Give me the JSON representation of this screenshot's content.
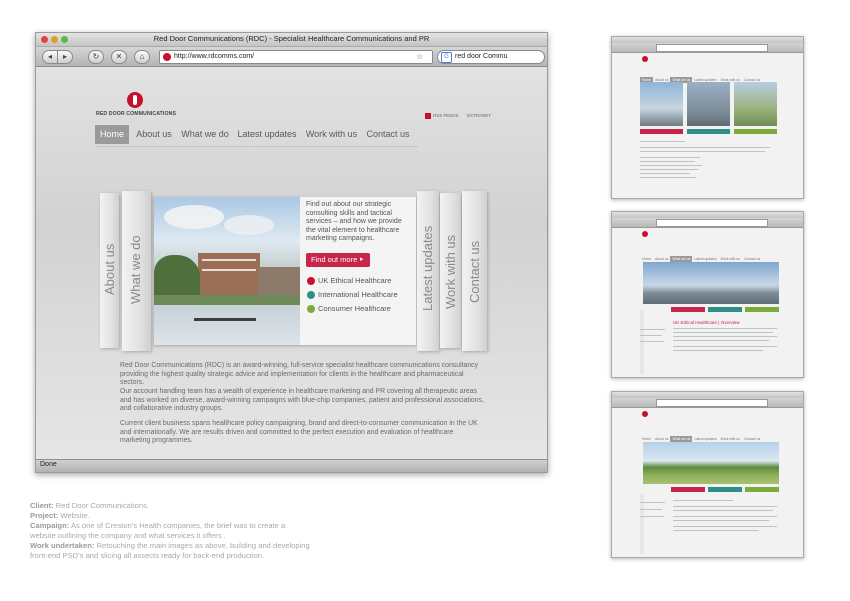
{
  "main_window": {
    "title": "Red Door Communications (RDC) - Specialist Healthcare Communications and PR",
    "url": "http://www.rdcomms.com/",
    "search_text": "red door Commu",
    "status": "Done"
  },
  "site": {
    "logo_text": "RED DOOR COMMUNICATIONS",
    "rss_label": "RSS FEEDS",
    "extranet_label": "EXTRANET",
    "nav": [
      "Home",
      "About us",
      "What we do",
      "Latest updates",
      "Work with us",
      "Contact us"
    ],
    "spines_left": [
      "About us",
      "What we do"
    ],
    "spines_right": [
      "Latest updates",
      "Work with us",
      "Contact us"
    ],
    "hero_text": "Find out about our strategic consulting skills and tactical services – and how we provide the vital element to healthcare marketing campaigns.",
    "cta_label": "Find out more",
    "segments": [
      {
        "label": "UK Ethical Healthcare",
        "color": "#c8102e"
      },
      {
        "label": "International Healthcare",
        "color": "#2f8f86"
      },
      {
        "label": "Consumer Healthcare",
        "color": "#7cab3c"
      }
    ],
    "paragraphs": [
      "Red Door Communications (RDC) is an award-winning, full-service specialist healthcare communications consultancy providing the highest quality strategic advice and implementation for clients in the healthcare and pharmaceutical sectors.",
      "Our account handling team has a wealth of experience in healthcare marketing and PR covering all therapeutic areas and has worked on diverse, award-winning campaigns with blue-chip companies, patient and professional associations, and collaborative industry groups.",
      "Current client business spans healthcare policy campaigning, brand and direct-to-consumer communication in the UK and internationally. We are results driven and committed to the perfect execution and evaluation of healthcare marketing programmes."
    ]
  },
  "thumbnails": [
    {
      "nav": [
        "Home",
        "About us",
        "What we do",
        "Latest updates",
        "Work with us",
        "Contact us"
      ]
    },
    {
      "nav": [
        "Home",
        "About us",
        "What we do",
        "Latest updates",
        "Work with us",
        "Contact us"
      ],
      "heading": "UK Ethical Healthcare | Overview"
    },
    {
      "nav": [
        "Home",
        "About us",
        "What we do",
        "Latest updates",
        "Work with us",
        "Contact us"
      ]
    }
  ],
  "caption": {
    "client_label": "Client:",
    "client": "Red Door Communications.",
    "project_label": "Project:",
    "project": "Website.",
    "campaign_label": "Campaign:",
    "campaign": "As one of Creston’s Health companies, the brief was to create a website outlining the company and what services it offers .",
    "work_label": "Work undertaken:",
    "work": "Retouching the main images as above, building and developing front-end PSD’s and slicing all assects ready for back-end production."
  },
  "colors": {
    "brand_red": "#c8102e",
    "teal": "#2f8f86",
    "green": "#7cab3c",
    "nav_active": "#9a9a9a"
  }
}
